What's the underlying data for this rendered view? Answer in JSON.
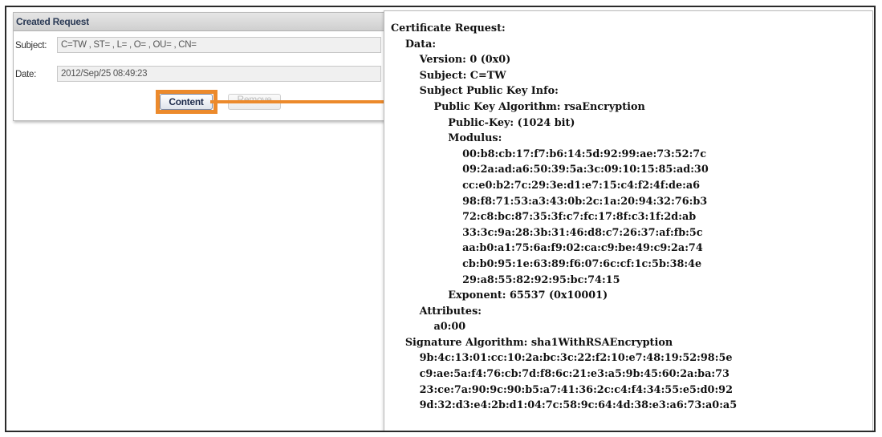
{
  "request_panel": {
    "title": "Created Request",
    "subject_label": "Subject:",
    "subject_value": "C=TW , ST= , L= , O= , OU= , CN=",
    "date_label": "Date:",
    "date_value": "2012/Sep/25 08:49:23",
    "content_button": "Content",
    "remove_button": "Remove"
  },
  "colors": {
    "highlight": "#ec8a2c",
    "header_text": "#2b3a55"
  },
  "certificate": {
    "lines": [
      "Certificate Request:",
      "    Data:",
      "        Version: 0 (0x0)",
      "        Subject: C=TW",
      "        Subject Public Key Info:",
      "            Public Key Algorithm: rsaEncryption",
      "                Public-Key: (1024 bit)",
      "                Modulus:",
      "                    00:b8:cb:17:f7:b6:14:5d:92:99:ae:73:52:7c",
      "                    09:2a:ad:a6:50:39:5a:3c:09:10:15:85:ad:30",
      "                    cc:e0:b2:7c:29:3e:d1:e7:15:c4:f2:4f:de:a6",
      "                    98:f8:71:53:a3:43:0b:2c:1a:20:94:32:76:b3",
      "                    72:c8:bc:87:35:3f:c7:fc:17:8f:c3:1f:2d:ab",
      "                    33:3c:9a:28:3b:31:46:d8:c7:26:37:af:fb:5c",
      "                    aa:b0:a1:75:6a:f9:02:ca:c9:be:49:c9:2a:74",
      "                    cb:b0:95:1e:63:89:f6:07:6c:cf:1c:5b:38:4e",
      "                    29:a8:55:82:92:95:bc:74:15",
      "                Exponent: 65537 (0x10001)",
      "        Attributes:",
      "            a0:00",
      "    Signature Algorithm: sha1WithRSAEncryption",
      "        9b:4c:13:01:cc:10:2a:bc:3c:22:f2:10:e7:48:19:52:98:5e",
      "        c9:ae:5a:f4:76:cb:7d:f8:6c:21:e3:a5:9b:45:60:2a:ba:73",
      "        23:ce:7a:90:9c:90:b5:a7:41:36:2c:c4:f4:34:55:e5:d0:92",
      "        9d:32:d3:e4:2b:d1:04:7c:58:9c:64:4d:38:e3:a6:73:a0:a5"
    ]
  }
}
